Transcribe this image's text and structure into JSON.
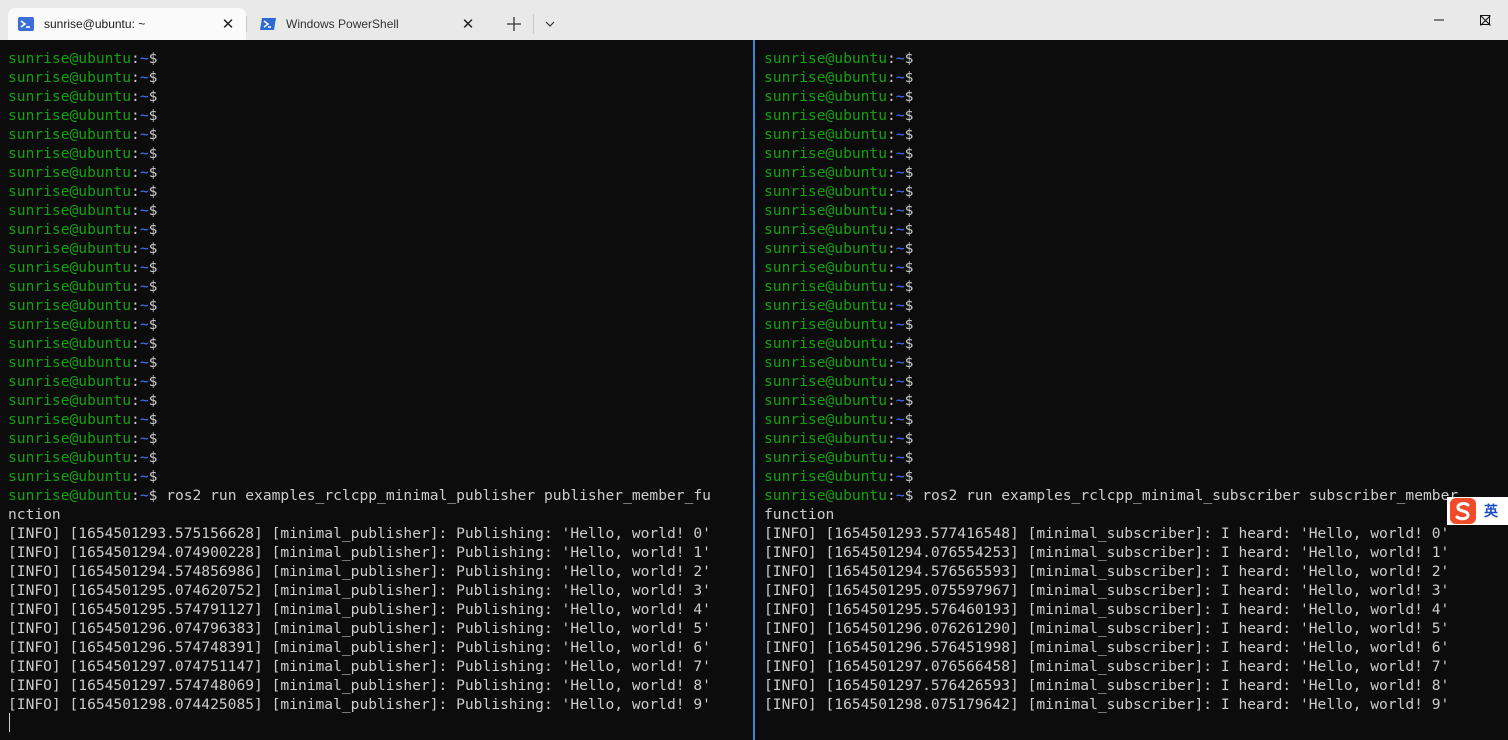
{
  "tabs": [
    {
      "label": "sunrise@ubuntu: ~",
      "active": true
    },
    {
      "label": "Windows PowerShell",
      "active": false
    }
  ],
  "window_controls": [
    "minimize",
    "maximize",
    "close"
  ],
  "prompt": {
    "user": "sunrise@ubuntu",
    "separator": ":",
    "path": "~",
    "symbol": "$"
  },
  "colors": {
    "prompt_user": "#13a10e",
    "prompt_path": "#3b78ff",
    "text": "#cccccc",
    "background": "#0c0c0c",
    "active_pane": "#3a88d6"
  },
  "left_pane": {
    "empty_prompts": 23,
    "command": " ros2 run examples_rclcpp_minimal_publisher publisher_member_fu",
    "command_wrap": "nction",
    "output": [
      "[INFO] [1654501293.575156628] [minimal_publisher]: Publishing: 'Hello, world! 0'",
      "[INFO] [1654501294.074900228] [minimal_publisher]: Publishing: 'Hello, world! 1'",
      "[INFO] [1654501294.574856986] [minimal_publisher]: Publishing: 'Hello, world! 2'",
      "[INFO] [1654501295.074620752] [minimal_publisher]: Publishing: 'Hello, world! 3'",
      "[INFO] [1654501295.574791127] [minimal_publisher]: Publishing: 'Hello, world! 4'",
      "[INFO] [1654501296.074796383] [minimal_publisher]: Publishing: 'Hello, world! 5'",
      "[INFO] [1654501296.574748391] [minimal_publisher]: Publishing: 'Hello, world! 6'",
      "[INFO] [1654501297.074751147] [minimal_publisher]: Publishing: 'Hello, world! 7'",
      "[INFO] [1654501297.574748069] [minimal_publisher]: Publishing: 'Hello, world! 8'",
      "[INFO] [1654501298.074425085] [minimal_publisher]: Publishing: 'Hello, world! 9'"
    ]
  },
  "right_pane": {
    "empty_prompts": 23,
    "command": " ros2 run examples_rclcpp_minimal_subscriber subscriber_member_",
    "command_wrap": "function",
    "output": [
      "[INFO] [1654501293.577416548] [minimal_subscriber]: I heard: 'Hello, world! 0'",
      "[INFO] [1654501294.076554253] [minimal_subscriber]: I heard: 'Hello, world! 1'",
      "[INFO] [1654501294.576565593] [minimal_subscriber]: I heard: 'Hello, world! 2'",
      "[INFO] [1654501295.075597967] [minimal_subscriber]: I heard: 'Hello, world! 3'",
      "[INFO] [1654501295.576460193] [minimal_subscriber]: I heard: 'Hello, world! 4'",
      "[INFO] [1654501296.076261290] [minimal_subscriber]: I heard: 'Hello, world! 5'",
      "[INFO] [1654501296.576451998] [minimal_subscriber]: I heard: 'Hello, world! 6'",
      "[INFO] [1654501297.076566458] [minimal_subscriber]: I heard: 'Hello, world! 7'",
      "[INFO] [1654501297.576426593] [minimal_subscriber]: I heard: 'Hello, world! 8'",
      "[INFO] [1654501298.075179642] [minimal_subscriber]: I heard: 'Hello, world! 9'"
    ]
  },
  "ime": {
    "label": "英"
  }
}
